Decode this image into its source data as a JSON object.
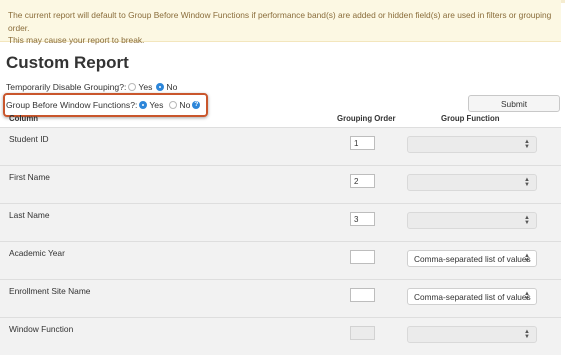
{
  "alert": {
    "line1": "The current report will default to Group Before Window Functions if performance band(s) are added or hidden field(s) are used in filters or grouping order.",
    "line2": "This may cause your report to break."
  },
  "page_title": "Custom Report",
  "options": {
    "disable_grouping": {
      "label": "Temporarily Disable Grouping?:",
      "yes": "Yes",
      "no": "No",
      "selected": "No"
    },
    "group_before_window": {
      "label": "Group Before Window Functions?:",
      "yes": "Yes",
      "no": "No",
      "selected": "Yes",
      "help_icon": "help-icon",
      "help_glyph": "?"
    }
  },
  "submit_label": "Submit",
  "table": {
    "headers": {
      "column": "Column",
      "grouping_order": "Grouping Order",
      "group_function": "Group Function"
    },
    "rows": [
      {
        "column": "Student ID",
        "grouping_order": "1",
        "group_function": "",
        "function_enabled": false
      },
      {
        "column": "First Name",
        "grouping_order": "2",
        "group_function": "",
        "function_enabled": false
      },
      {
        "column": "Last Name",
        "grouping_order": "3",
        "group_function": "",
        "function_enabled": false
      },
      {
        "column": "Academic Year",
        "grouping_order": "",
        "group_function": "Comma-separated list of values",
        "function_enabled": true
      },
      {
        "column": "Enrollment Site Name",
        "grouping_order": "",
        "group_function": "Comma-separated list of values",
        "function_enabled": true
      },
      {
        "column": "Window Function",
        "grouping_order": "",
        "group_function": "",
        "function_enabled": false,
        "order_disabled": true
      }
    ]
  },
  "colors": {
    "accent": "#2d86d9",
    "highlight_border": "#c9562c",
    "alert_bg": "#fcf8e3",
    "alert_text": "#8a6d3b"
  }
}
